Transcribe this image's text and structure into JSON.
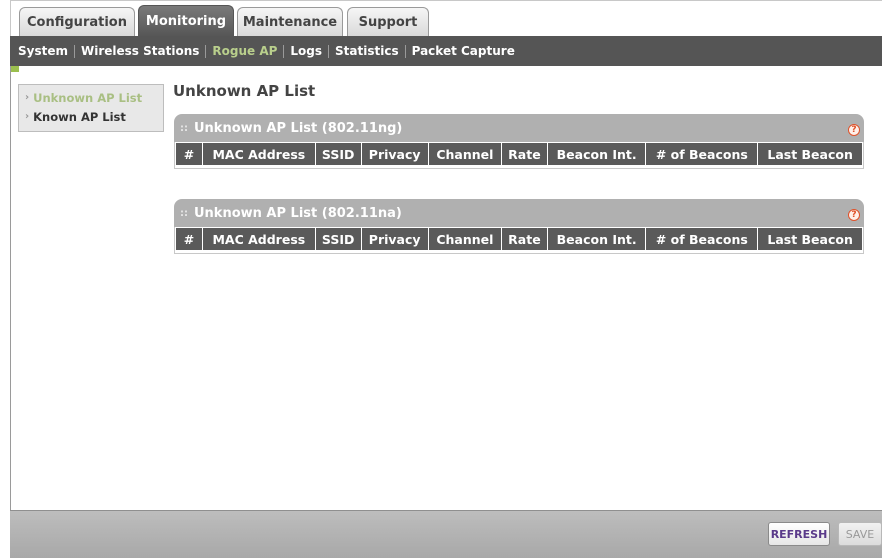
{
  "tabs": [
    {
      "label": "Configuration"
    },
    {
      "label": "Monitoring"
    },
    {
      "label": "Maintenance"
    },
    {
      "label": "Support"
    }
  ],
  "subnav": [
    {
      "label": "System"
    },
    {
      "label": "Wireless Stations"
    },
    {
      "label": "Rogue AP"
    },
    {
      "label": "Logs"
    },
    {
      "label": "Statistics"
    },
    {
      "label": "Packet Capture"
    }
  ],
  "sidenav": [
    {
      "label": "Unknown AP List"
    },
    {
      "label": "Known AP List"
    }
  ],
  "page_title": "Unknown AP List",
  "panels": [
    {
      "title": "Unknown AP List (802.11ng)",
      "help": "?"
    },
    {
      "title": "Unknown AP List (802.11na)",
      "help": "?"
    }
  ],
  "columns": [
    "#",
    "MAC Address",
    "SSID",
    "Privacy",
    "Channel",
    "Rate",
    "Beacon Int.",
    "# of Beacons",
    "Last Beacon"
  ],
  "footer": {
    "refresh_label": "REFRESH",
    "save_label": "SAVE"
  },
  "colors": {
    "active_nav": "#b9cf8c",
    "header_bg": "#555555",
    "panel_head": "#b0b0b0",
    "help": "#e0522a"
  }
}
